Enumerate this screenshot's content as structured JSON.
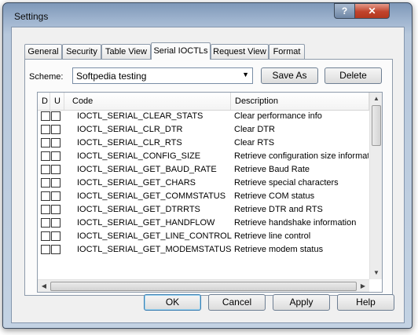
{
  "window": {
    "title": "Settings",
    "help_label": "?",
    "close_label": "✕"
  },
  "tabs": [
    {
      "label": "General"
    },
    {
      "label": "Security"
    },
    {
      "label": "Table View"
    },
    {
      "label": "Serial IOCTLs",
      "active": true
    },
    {
      "label": "Request View"
    },
    {
      "label": "Format"
    }
  ],
  "scheme": {
    "label": "Scheme:",
    "value": "Softpedia testing",
    "save_as": "Save As",
    "delete": "Delete"
  },
  "list": {
    "headers": {
      "d": "D",
      "u": "U",
      "code": "Code",
      "description": "Description"
    },
    "rows": [
      {
        "code": "IOCTL_SERIAL_CLEAR_STATS",
        "description": "Clear performance info"
      },
      {
        "code": "IOCTL_SERIAL_CLR_DTR",
        "description": "Clear DTR"
      },
      {
        "code": "IOCTL_SERIAL_CLR_RTS",
        "description": "Clear RTS"
      },
      {
        "code": "IOCTL_SERIAL_CONFIG_SIZE",
        "description": "Retrieve configuration size information"
      },
      {
        "code": "IOCTL_SERIAL_GET_BAUD_RATE",
        "description": "Retrieve Baud Rate"
      },
      {
        "code": "IOCTL_SERIAL_GET_CHARS",
        "description": "Retrieve special characters"
      },
      {
        "code": "IOCTL_SERIAL_GET_COMMSTATUS",
        "description": "Retrieve COM status"
      },
      {
        "code": "IOCTL_SERIAL_GET_DTRRTS",
        "description": "Retrieve DTR and RTS"
      },
      {
        "code": "IOCTL_SERIAL_GET_HANDFLOW",
        "description": "Retrieve handshake information"
      },
      {
        "code": "IOCTL_SERIAL_GET_LINE_CONTROL",
        "description": "Retrieve line control"
      },
      {
        "code": "IOCTL_SERIAL_GET_MODEMSTATUS",
        "description": "Retrieve modem status"
      }
    ]
  },
  "buttons": {
    "ok": "OK",
    "cancel": "Cancel",
    "apply": "Apply",
    "help": "Help"
  }
}
